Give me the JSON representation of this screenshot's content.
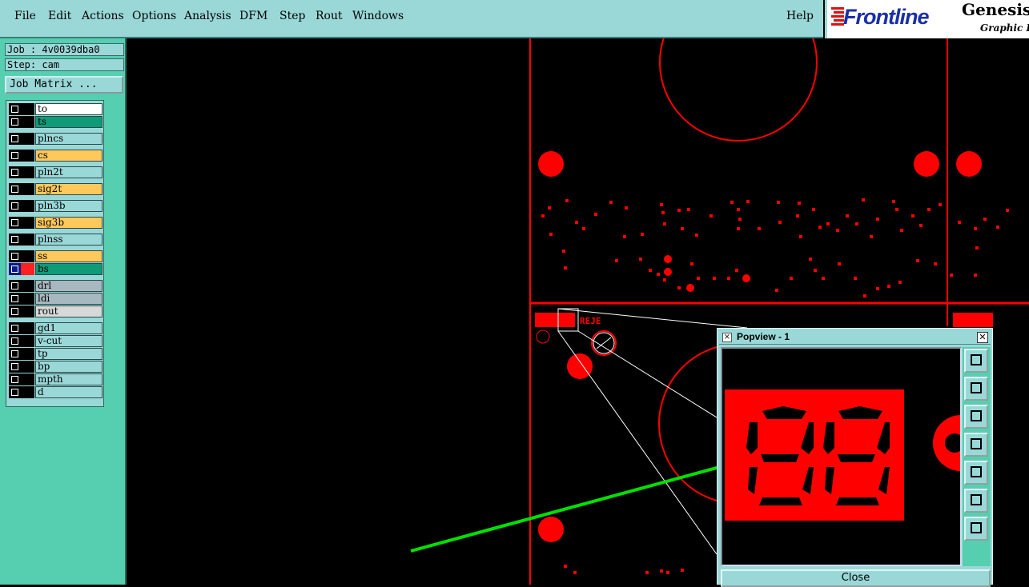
{
  "menu": {
    "items": [
      "File",
      "Edit",
      "Actions",
      "Options",
      "Analysis",
      "DFM",
      "Step",
      "Rout",
      "Windows"
    ],
    "help": "Help"
  },
  "logo": {
    "brand": "Frontline",
    "product": "Genesis",
    "subtitle": "Graphic E"
  },
  "job": {
    "job_line": "Job : 4v0039dba0",
    "step_line": "Step: cam",
    "matrix_button": "Job Matrix ..."
  },
  "layers": [
    {
      "name": "to",
      "color": "#ffffff"
    },
    {
      "name": "ts",
      "color": "#0f9a78"
    },
    {
      "name": "plncs",
      "color": "#9ad8d8"
    },
    {
      "name": "cs",
      "color": "#ffc85a"
    },
    {
      "name": "pln2t",
      "color": "#9ad8d8"
    },
    {
      "name": "sig2t",
      "color": "#ffc85a"
    },
    {
      "name": "pln3b",
      "color": "#9ad8d8"
    },
    {
      "name": "sig3b",
      "color": "#ffc85a"
    },
    {
      "name": "plnss",
      "color": "#9ad8d8"
    },
    {
      "name": "ss",
      "color": "#ffc85a"
    },
    {
      "name": "bs",
      "color": "#0f9a78"
    },
    {
      "name": "drl",
      "color": "#a8b8c0"
    },
    {
      "name": "ldi",
      "color": "#a8b8c0"
    },
    {
      "name": "rout",
      "color": "#d8d8d8"
    },
    {
      "name": "gd1",
      "color": "#9ad8d8"
    },
    {
      "name": "v-cut",
      "color": "#9ad8d8"
    },
    {
      "name": "tp",
      "color": "#9ad8d8"
    },
    {
      "name": "bp",
      "color": "#9ad8d8"
    },
    {
      "name": "mpth",
      "color": "#9ad8d8"
    },
    {
      "name": "d",
      "color": "#9ad8d8"
    }
  ],
  "popview": {
    "title": "Popview - 1",
    "close_label": "Close",
    "tools": [
      "zoom-fit-icon",
      "pan-up-icon",
      "pan-down-icon",
      "pan-left-icon",
      "pan-right-icon",
      "zoom-in-icon",
      "zoom-out-icon"
    ]
  },
  "canvas": {
    "feature_color": "#ff0000",
    "annotation_arrow_color": "#00e000",
    "label_text": "REJE"
  }
}
